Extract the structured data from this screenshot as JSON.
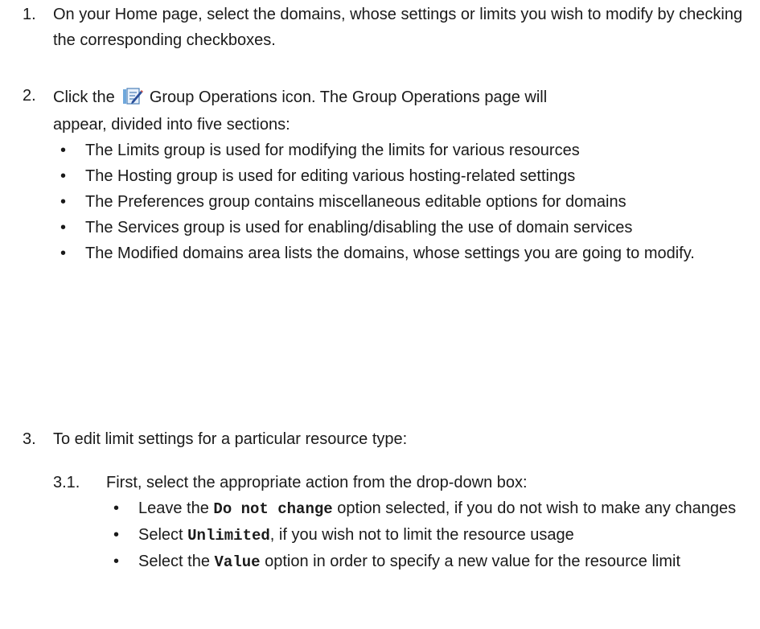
{
  "steps": [
    {
      "num": "1.",
      "text": "On your Home page, select the domains, whose settings or limits you wish to modify by checking the corresponding checkboxes."
    },
    {
      "num": "2.",
      "pre": "Click the",
      "icon": "group-operations-icon",
      "post": "Group Operations icon. The Group Operations page will",
      "cont": "appear, divided into five sections:",
      "bullets": [
        "The Limits group is used for modifying the limits for various resources",
        "The Hosting group is used for editing various hosting-related settings",
        "The Preferences group contains miscellaneous editable options for domains",
        "The Services group is used for enabling/disabling the use of domain services",
        "The Modified domains area lists the domains, whose settings you are going to modify."
      ]
    },
    {
      "num": "3.",
      "text": "To edit limit settings for a particular resource type:",
      "sub": {
        "num": "3.1.",
        "text": "First, select the appropriate action from the drop-down box:",
        "bullets": [
          {
            "pre": "Leave the ",
            "code": "Do not change",
            "post": " option selected, if you do not wish to make any changes"
          },
          {
            "pre": "Select ",
            "code": "Unlimited",
            "post": ", if you wish not to limit the resource usage"
          },
          {
            "pre": "Select the ",
            "code": "Value",
            "post": " option in order to specify a new value for the resource limit"
          }
        ]
      }
    }
  ]
}
